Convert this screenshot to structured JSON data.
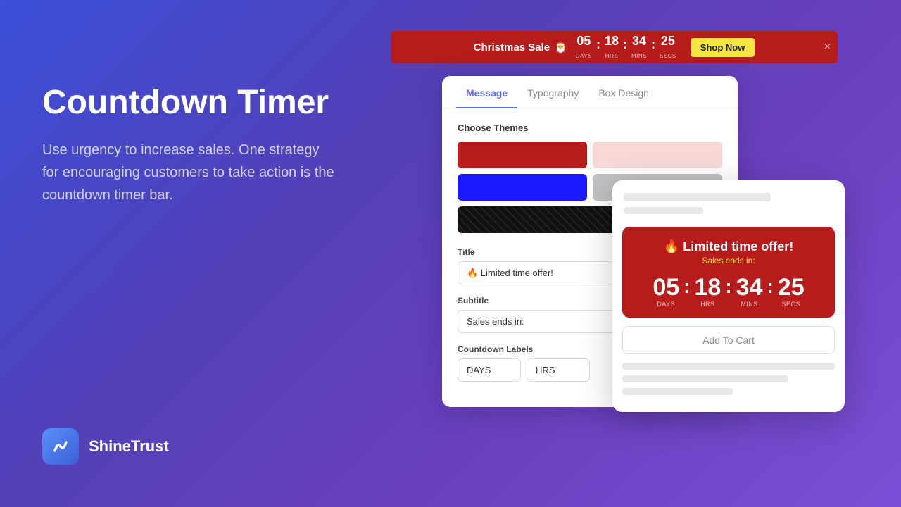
{
  "page": {
    "background": "gradient purple-blue"
  },
  "hero": {
    "title": "Countdown Timer",
    "description": "Use urgency to increase sales. One strategy for encouraging customers to take action is the countdown timer bar."
  },
  "brand": {
    "name": "ShineTrust",
    "logo_text": "S"
  },
  "banner": {
    "title": "Christmas Sale",
    "emoji": "🎅",
    "days_num": "05",
    "days_label": "DAYS",
    "hrs_num": "18",
    "hrs_label": "HRS",
    "mins_num": "34",
    "mins_label": "MINS",
    "secs_num": "25",
    "secs_label": "SECS",
    "shop_now": "Shop Now",
    "close_label": "×"
  },
  "panel": {
    "tabs": [
      {
        "id": "message",
        "label": "Message",
        "active": true
      },
      {
        "id": "typography",
        "label": "Typography",
        "active": false
      },
      {
        "id": "box-design",
        "label": "Box Design",
        "active": false
      }
    ],
    "choose_themes_label": "Choose Themes",
    "themes": [
      {
        "id": "red",
        "label": "Red theme"
      },
      {
        "id": "pink",
        "label": "Pink theme"
      },
      {
        "id": "blue",
        "label": "Blue theme"
      },
      {
        "id": "gray",
        "label": "Gray theme"
      },
      {
        "id": "dark",
        "label": "Dark pattern theme"
      }
    ],
    "title_label": "Title",
    "title_value": "🔥 Limited time offer!",
    "subtitle_label": "Subtitle",
    "subtitle_value": "Sales ends in:",
    "countdown_labels_label": "Countdown Labels",
    "days_input": "DAYS",
    "hrs_input": "HRS"
  },
  "overlay": {
    "widget": {
      "title": "🔥 Limited time offer!",
      "subtitle": "Sales ends in:",
      "days_num": "05",
      "days_label": "DAYS",
      "hrs_num": "18",
      "hrs_label": "HRS",
      "mins_num": "34",
      "mins_label": "MINS",
      "secs_num": "25",
      "secs_label": "SECS"
    },
    "add_to_cart": "Add To Cart"
  }
}
